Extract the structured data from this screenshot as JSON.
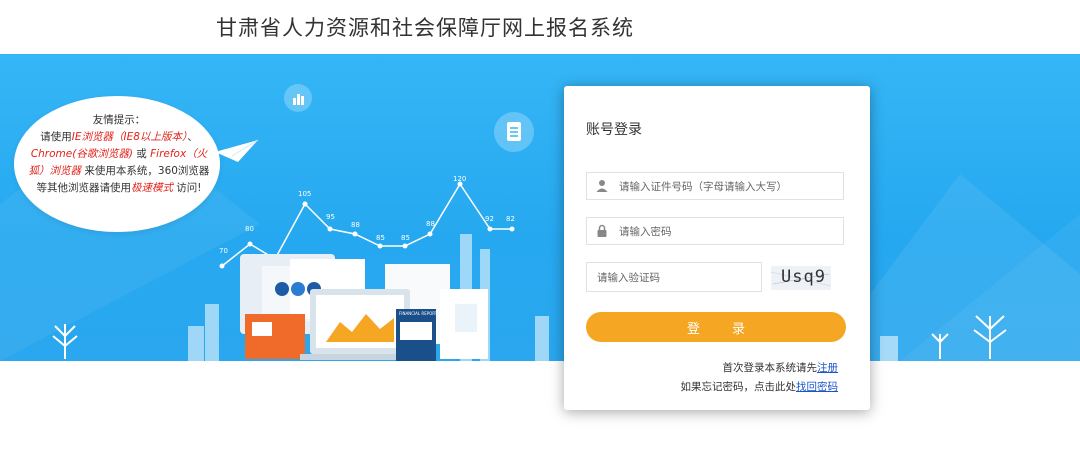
{
  "header": {
    "title": "甘肃省人力资源和社会保障厅网上报名系统"
  },
  "tip": {
    "title": "友情提示：",
    "line1_a": "请使用",
    "line1_red": "IE浏览器（IE8以上版本）",
    "line1_b": "、",
    "line2_red": "Chrome(谷歌浏览器)",
    "line2_b": " 或 ",
    "line2_red2": "Firefox（火",
    "line3_red": "狐）浏览器",
    "line3_b": " 来使用本系统，360浏览器",
    "line4_a": "等其他浏览器请使用",
    "line4_red": "极速模式",
    "line4_b": " 访问!"
  },
  "chart_labels": [
    "70",
    "80",
    "105",
    "95",
    "88",
    "85",
    "85",
    "88",
    "120",
    "92",
    "82"
  ],
  "login": {
    "title": "账号登录",
    "id_placeholder": "请输入证件号码（字母请输入大写）",
    "password_placeholder": "请输入密码",
    "captcha_placeholder": "请输入验证码",
    "captcha_text": "Usq9",
    "submit_label": "登 录",
    "register_prefix": "首次登录本系统请先",
    "register_link": "注册",
    "forgot_prefix": "如果忘记密码，点击此处",
    "forgot_link": "找回密码"
  },
  "report_label": "FINANCIAL REPORT",
  "colors": {
    "banner": "#2aa9f0",
    "button": "#f5a623",
    "link": "#1a56c8",
    "tip_red": "#e2231a"
  }
}
